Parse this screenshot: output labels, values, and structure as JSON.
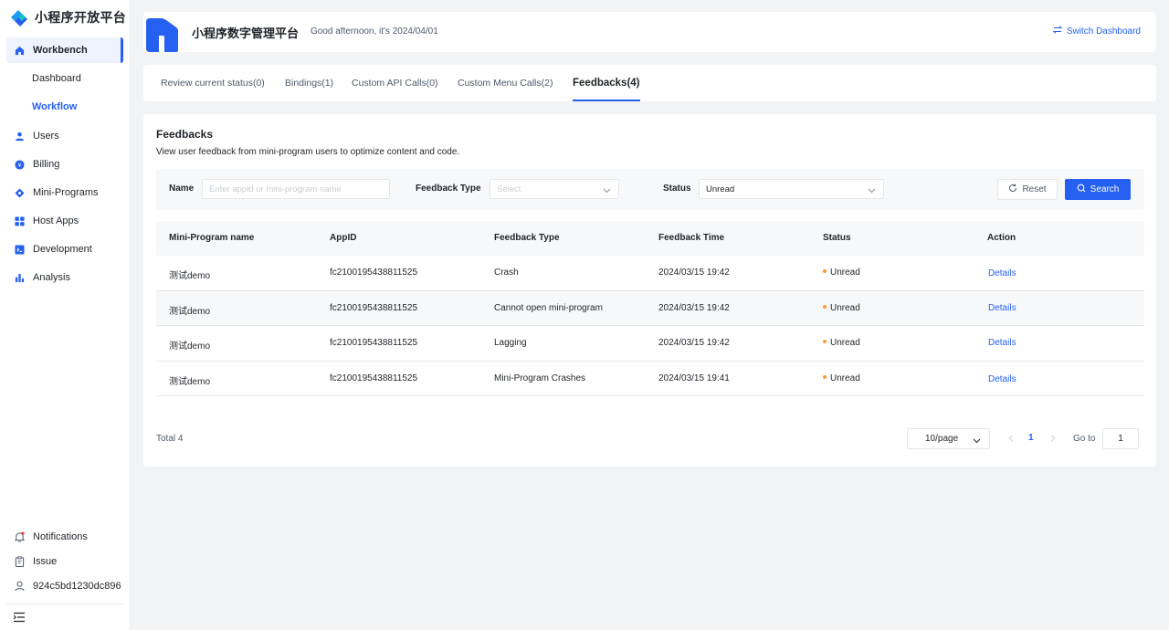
{
  "brand": {
    "title": "小程序开放平台"
  },
  "sidebar": {
    "items": [
      {
        "label": "Workbench",
        "icon": "home-icon"
      },
      {
        "label": "Users",
        "icon": "user-icon"
      },
      {
        "label": "Billing",
        "icon": "billing-icon"
      },
      {
        "label": "Mini-Programs",
        "icon": "mini-program-icon"
      },
      {
        "label": "Host Apps",
        "icon": "grid-icon"
      },
      {
        "label": "Development",
        "icon": "terminal-icon"
      },
      {
        "label": "Analysis",
        "icon": "bar-chart-icon"
      }
    ],
    "subitems": [
      {
        "label": "Dashboard"
      },
      {
        "label": "Workflow"
      }
    ],
    "bottom": [
      {
        "label": "Notifications",
        "icon": "bell-icon"
      },
      {
        "label": "Issue",
        "icon": "clipboard-icon"
      },
      {
        "label": "924c5bd1230dc896",
        "icon": "user-outline-icon"
      }
    ]
  },
  "header": {
    "app_name": "小程序数字管理平台",
    "greeting": "Good afternoon, it's  2024/04/01",
    "switch_label": "Switch Dashboard"
  },
  "tabs": [
    {
      "label": "Review current status(0)"
    },
    {
      "label": "Bindings(1)"
    },
    {
      "label": "Custom API Calls(0)"
    },
    {
      "label": "Custom Menu Calls(2)"
    },
    {
      "label": "Feedbacks(4)"
    }
  ],
  "active_tab": "Feedbacks(4)",
  "feedbacks": {
    "title": "Feedbacks",
    "description": "View user feedback from mini-program users to optimize content and code.",
    "filters": {
      "name_label": "Name",
      "name_placeholder": "Enter appid or mini-program name",
      "name_value": "",
      "type_label": "Feedback Type",
      "type_placeholder": "Select",
      "status_label": "Status",
      "status_value": "Unread",
      "reset_label": "Reset",
      "search_label": "Search"
    },
    "table": {
      "headers": [
        "Mini-Program name",
        "AppID",
        "Feedback Type",
        "Feedback Time",
        "Status",
        "Action"
      ],
      "rows": [
        {
          "name": "测试demo",
          "appid": "fc2100195438811525",
          "type": "Crash",
          "time": "2024/03/15 19:42",
          "status": "Unread",
          "action": "Details"
        },
        {
          "name": "测试demo",
          "appid": "fc2100195438811525",
          "type": "Cannot open mini-program",
          "time": "2024/03/15 19:42",
          "status": "Unread",
          "action": "Details"
        },
        {
          "name": "测试demo",
          "appid": "fc2100195438811525",
          "type": "Lagging",
          "time": "2024/03/15 19:42",
          "status": "Unread",
          "action": "Details"
        },
        {
          "name": "测试demo",
          "appid": "fc2100195438811525",
          "type": "Mini-Program Crashes",
          "time": "2024/03/15 19:41",
          "status": "Unread",
          "action": "Details"
        }
      ]
    },
    "pagination": {
      "total_label": "Total 4",
      "page_size": "10/page",
      "current_page": "1",
      "goto_label": "Go to",
      "goto_value": "1"
    }
  },
  "colors": {
    "accent": "#2560f0",
    "status_unread": "#ff9a2e",
    "background": "#f2f3f5"
  }
}
